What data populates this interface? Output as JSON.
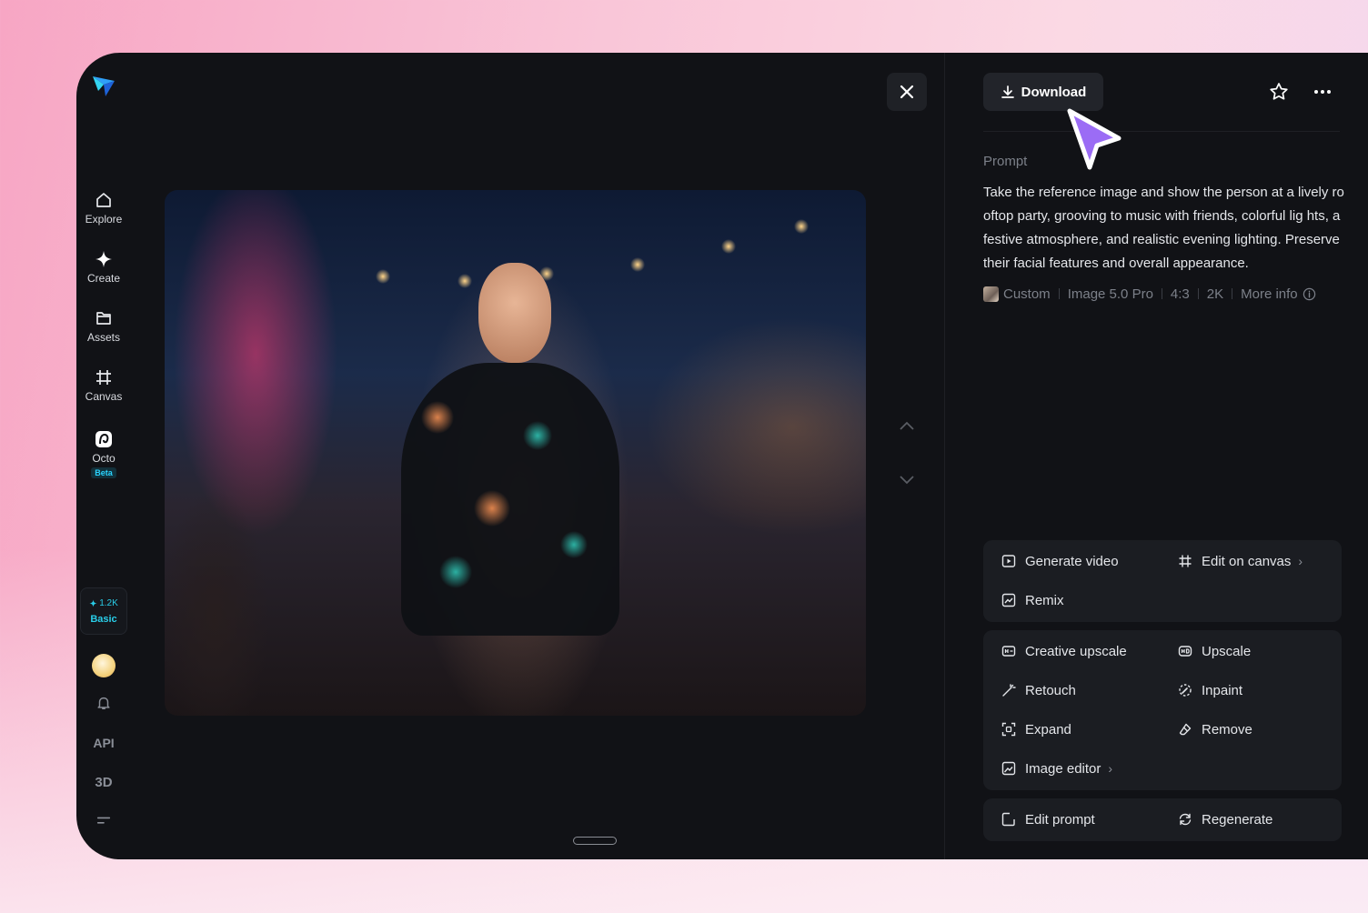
{
  "sidebar": {
    "nav": [
      {
        "label": "Explore",
        "icon": "home-icon"
      },
      {
        "label": "Create",
        "icon": "sparkle-icon"
      },
      {
        "label": "Assets",
        "icon": "folder-icon"
      },
      {
        "label": "Canvas",
        "icon": "canvas-icon"
      },
      {
        "label": "Octo",
        "icon": "octo-icon",
        "badge": "Beta"
      }
    ],
    "credits": {
      "amount": "1.2K",
      "plan": "Basic"
    },
    "api_label": "API",
    "three_d_label": "3D"
  },
  "viewer": {
    "image_alt": "Rooftop party photo"
  },
  "panel": {
    "download_label": "Download",
    "prompt_label": "Prompt",
    "prompt_text": "Take the reference image and show the person at a lively rooftop party, grooving to music with friends, colorful lig hts, a festive atmosphere, and realistic evening lighting. Preserve their facial features and overall appearance.",
    "meta": {
      "style": "Custom",
      "model": "Image 5.0 Pro",
      "ratio": "4:3",
      "resolution": "2K",
      "more_info": "More info"
    },
    "actions_primary": {
      "generate_video": "Generate video",
      "edit_on_canvas": "Edit on canvas",
      "remix": "Remix"
    },
    "actions_edit": {
      "creative_upscale": "Creative upscale",
      "upscale": "Upscale",
      "retouch": "Retouch",
      "inpaint": "Inpaint",
      "expand": "Expand",
      "remove": "Remove",
      "image_editor": "Image editor"
    },
    "actions_prompt": {
      "edit_prompt": "Edit prompt",
      "regenerate": "Regenerate"
    }
  },
  "colors": {
    "accent": "#29cde8",
    "window_bg": "#111216",
    "card_bg": "#1b1d22",
    "cursor": "#9b6cf5"
  }
}
